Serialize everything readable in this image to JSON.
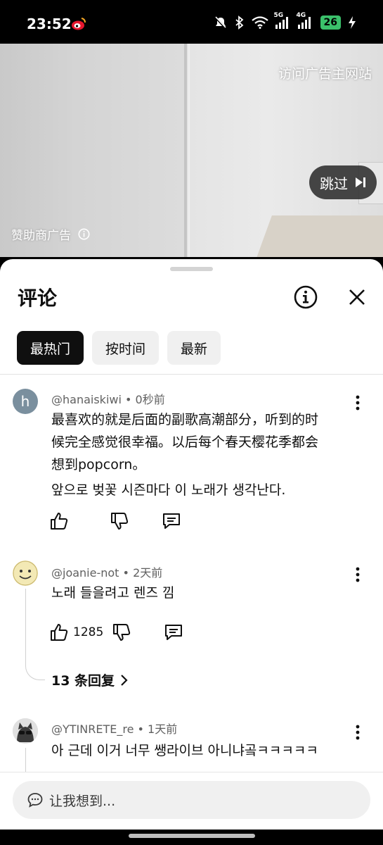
{
  "status_bar": {
    "time": "23:52",
    "net1": "5G",
    "net2": "4G",
    "battery": "26",
    "icons": [
      "weibo-icon",
      "mute-icon",
      "bluetooth-icon",
      "wifi-icon",
      "signal-icon",
      "battery-icon",
      "charging-icon"
    ]
  },
  "ad": {
    "visit_advertiser": "访问广告主网站",
    "skip_label": "跳过",
    "sponsor_label": "赞助商广告",
    "progress_color": "#e7b400"
  },
  "sheet": {
    "title": "评论",
    "chips": [
      "最热门",
      "按时间",
      "最新"
    ]
  },
  "comments": [
    {
      "avatar_letter": "h",
      "author": "@hanaiskiwi",
      "time": "0秒前",
      "text_lines": [
        "最喜欢的就是后面的副歌高潮部分，听到的时",
        "候完全感觉很幸福。以后每个春天樱花季都会",
        "想到popcorn。"
      ],
      "text_2": "앞으로 벚꽃 시즌마다 이 노래가 생각난다."
    },
    {
      "author": "@joanie-not",
      "time": "2天前",
      "text": "노래 들을려고 렌즈 낌",
      "like_count": "1285",
      "replies": "13 条回复"
    },
    {
      "author": "@YTINRETE_re",
      "time": "1天前",
      "text": "아 근데 이거 너무 쌩라이브 아니냐곸ㅋㅋㅋㅋㅋ"
    }
  ],
  "composer": {
    "placeholder": "让我想到..."
  },
  "colors": {
    "battery": "#3bc16b",
    "active_chip": "#0f0f0f",
    "chip": "#f0f0f0"
  }
}
